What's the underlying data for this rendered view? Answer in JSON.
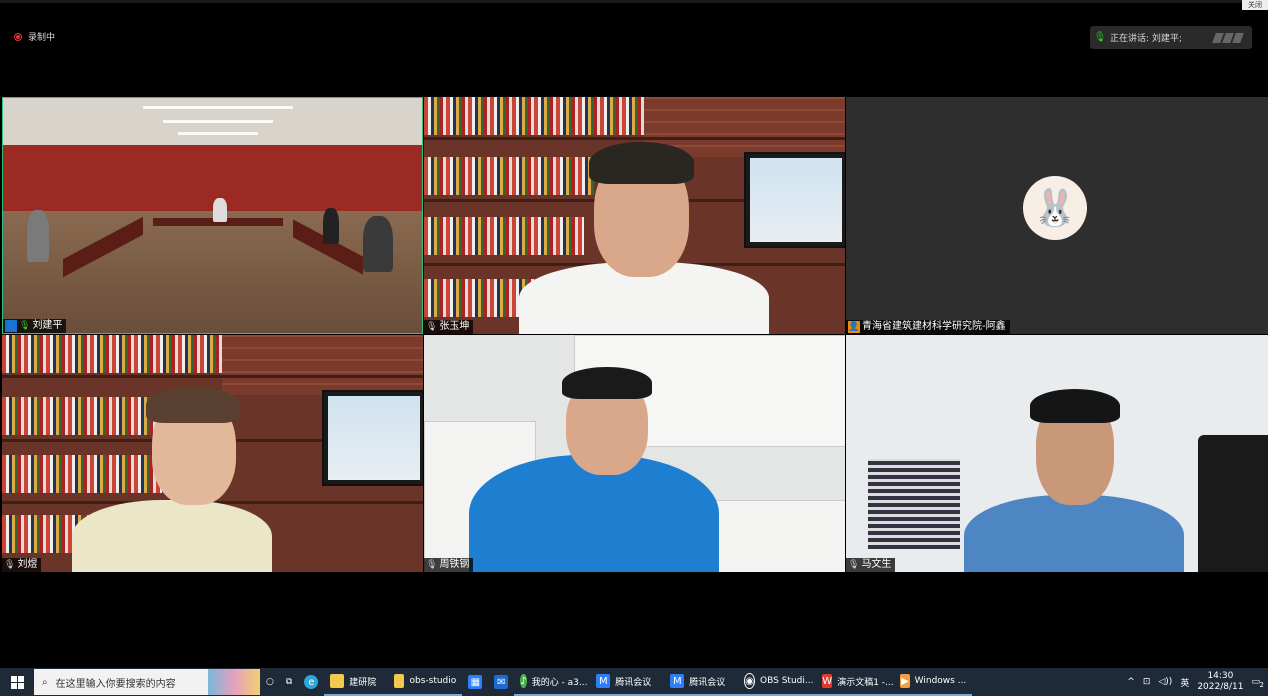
{
  "window": {
    "close_label": "关闭",
    "recording_label": "录制中",
    "speaking_label": "正在讲话: 刘建平;"
  },
  "participants": [
    {
      "name": "刘建平"
    },
    {
      "name": "张玉坤"
    },
    {
      "name": "青海省建筑建材科学研究院-阿鑫"
    },
    {
      "name": "刘煜"
    },
    {
      "name": "周铁钢"
    },
    {
      "name": "马文生"
    }
  ],
  "taskbar": {
    "search_placeholder": "在这里输入你要搜索的内容",
    "apps": [
      {
        "label": "建研院",
        "icon": "folder-icon",
        "color": "#f2c94c"
      },
      {
        "label": "obs-studio",
        "icon": "folder-icon",
        "color": "#f2c94c"
      },
      {
        "label": "我的心 - a3...",
        "icon": "music-icon",
        "color": "#4caf50"
      },
      {
        "label": "腾讯会议",
        "icon": "tencent-meeting-icon",
        "color": "#2d7ff9"
      },
      {
        "label": "腾讯会议",
        "icon": "tencent-meeting-icon",
        "color": "#2d7ff9"
      },
      {
        "label": "OBS Studi...",
        "icon": "obs-icon",
        "color": "#ffffff"
      },
      {
        "label": "演示文稿1 -...",
        "icon": "wps-icon",
        "color": "#e23b2e"
      },
      {
        "label": "Windows ...",
        "icon": "media-icon",
        "color": "#f2a03d"
      }
    ],
    "ime_label": "英",
    "time": "14:30",
    "date": "2022/8/11",
    "notification_count": "2"
  }
}
